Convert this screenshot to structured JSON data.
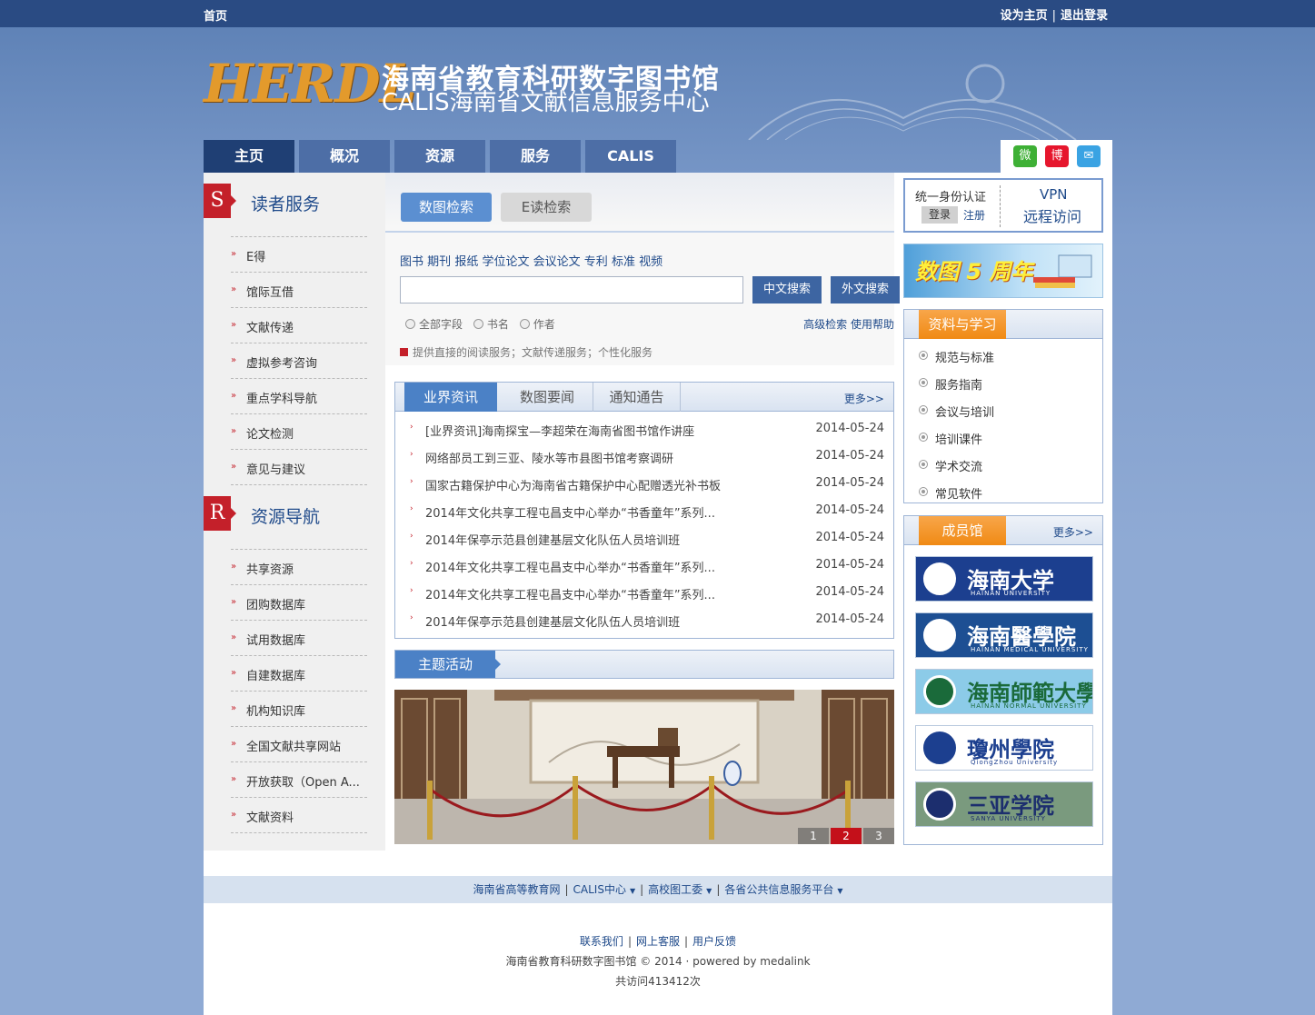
{
  "topbar": {
    "home": "首页",
    "set_home": "设为主页",
    "logout": "退出登录",
    "sep": "|"
  },
  "banner": {
    "logo_en": "HERDL",
    "title_cn": "海南省教育科研数字图书馆",
    "title_sub": "CALIS海南省文献信息服务中心"
  },
  "nav": {
    "items": [
      "主页",
      "概况",
      "资源",
      "服务",
      "CALIS"
    ]
  },
  "social": {
    "wechat": "微",
    "weibo": "博",
    "mail": "✉"
  },
  "reader_service": {
    "badge": "S",
    "title": "读者服务",
    "items": [
      "E得",
      "馆际互借",
      "文献传递",
      "虚拟参考咨询",
      "重点学科导航",
      "论文检测",
      "意见与建议"
    ]
  },
  "resource_nav": {
    "badge": "R",
    "title": "资源导航",
    "items": [
      "共享资源",
      "团购数据库",
      "试用数据库",
      "自建数据库",
      "机构知识库",
      "全国文献共享网站",
      "开放获取（Open A...",
      "文献资料"
    ]
  },
  "search": {
    "tab_active": "数图检索",
    "tab_inactive": "E读检索",
    "types": [
      "图书",
      "期刊",
      "报纸",
      "学位论文",
      "会议论文",
      "专利",
      "标准",
      "视频"
    ],
    "input_value": "",
    "btn_cn": "中文搜索",
    "btn_foreign": "外文搜索",
    "options": [
      "全部字段",
      "书名",
      "作者"
    ],
    "advanced": "高级检索",
    "help": "使用帮助",
    "note": "提供直接的阅读服务；文献传递服务；个性化服务"
  },
  "news": {
    "tabs": [
      "业界资讯",
      "数图要闻",
      "通知通告"
    ],
    "more": "更多>>",
    "rows": [
      {
        "title": "[业界资讯]海南探宝—李超荣在海南省图书馆作讲座",
        "date": "2014-05-24"
      },
      {
        "title": "网络部员工到三亚、陵水等市县图书馆考察调研",
        "date": "2014-05-24"
      },
      {
        "title": "国家古籍保护中心为海南省古籍保护中心配赠透光补书板",
        "date": "2014-05-24"
      },
      {
        "title": "2014年文化共享工程屯昌支中心举办“书香童年”系列...",
        "date": "2014-05-24"
      },
      {
        "title": "2014年保亭示范县创建基层文化队伍人员培训班",
        "date": "2014-05-24"
      },
      {
        "title": "2014年文化共享工程屯昌支中心举办“书香童年”系列...",
        "date": "2014-05-24"
      },
      {
        "title": "2014年文化共享工程屯昌支中心举办“书香童年”系列...",
        "date": "2014-05-24"
      },
      {
        "title": "2014年保亭示范县创建基层文化队伍人员培训班",
        "date": "2014-05-24"
      }
    ]
  },
  "theme": {
    "title": "主题活动",
    "pages": [
      "1",
      "2",
      "3"
    ],
    "current_page": "2"
  },
  "vpn": {
    "auth": "统一身份认证",
    "login": "登录",
    "register": "注册",
    "vpn": "VPN",
    "remote": "远程访问"
  },
  "anniversary": {
    "text": "数图 5 周年"
  },
  "study": {
    "title": "资料与学习",
    "items": [
      "规范与标准",
      "服务指南",
      "会议与培训",
      "培训课件",
      "学术交流",
      "常见软件"
    ]
  },
  "members": {
    "title": "成员馆",
    "more": "更多>>",
    "items": [
      {
        "name": "海南大学",
        "en": "HAINAN UNIVERSITY",
        "bg": "#1c3f8f",
        "fg": "#ffffff"
      },
      {
        "name": "海南醫學院",
        "en": "HAINAN MEDICAL UNIVERSITY",
        "bg": "#1d4f93",
        "fg": "#ffffff"
      },
      {
        "name": "海南師範大學",
        "en": "HAINAN NORMAL UNIVERSITY",
        "bg": "#8ccbe8",
        "fg": "#1a6a3a"
      },
      {
        "name": "瓊州學院",
        "en": "QiongZhou University",
        "bg": "#ffffff",
        "fg": "#1c3f8f"
      },
      {
        "name": "三亚学院",
        "en": "SANYA UNIVERSITY",
        "bg": "#7a9a7e",
        "fg": "#1c2e6e"
      }
    ]
  },
  "footer": {
    "links": [
      "海南省高等教育网",
      "CALIS中心",
      "高校图工委",
      "各省公共信息服务平台"
    ],
    "contact": "联系我们",
    "online": "网上客服",
    "feedback": "用户反馈",
    "copyright": "海南省教育科研数字图书馆 © 2014 · powered by medalink",
    "visits": "共访问413412次"
  },
  "colors": {
    "nav": "#4d6ea6",
    "nav_active": "#1f3f74",
    "accent_red": "#c4202a",
    "tab_blue": "#4b81c6",
    "orange": "#f08a14"
  }
}
